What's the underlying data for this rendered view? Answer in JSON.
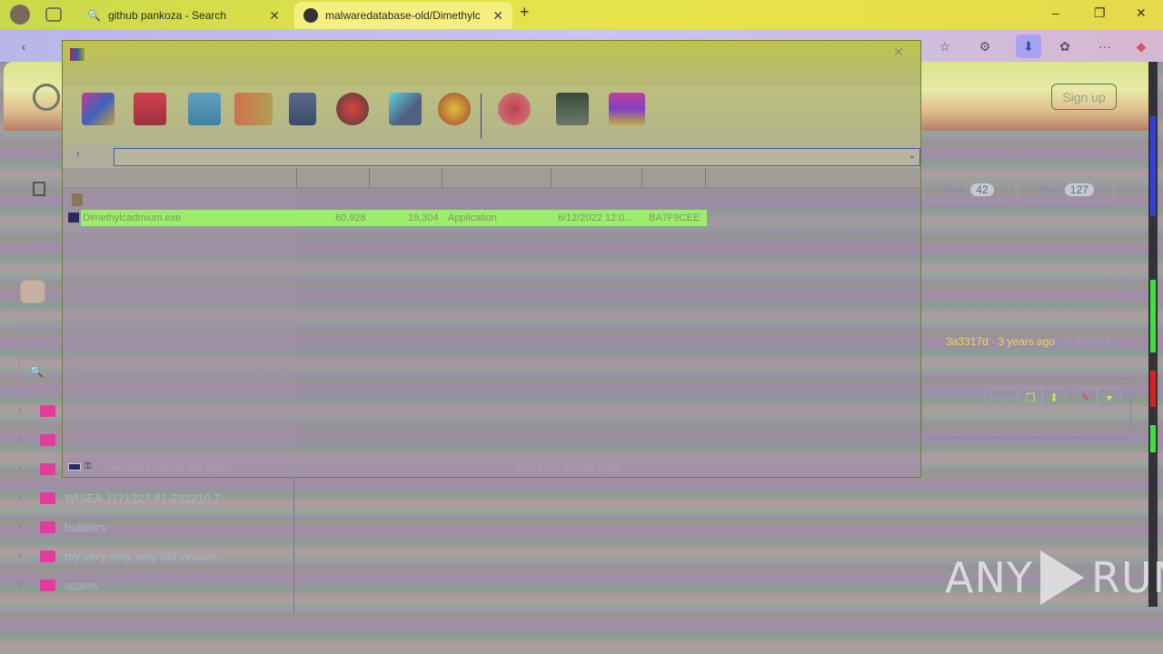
{
  "browser": {
    "tabs": [
      {
        "title": "github pankoza - Search",
        "active": false
      },
      {
        "title": "malwaredatabase-old/Dimethylc",
        "active": true
      }
    ],
    "new_tab_glyph": "+",
    "window_controls": [
      "–",
      "❐",
      "✕"
    ]
  },
  "github": {
    "sign_up": "Sign up",
    "fork": {
      "label": "Fork",
      "count": "42"
    },
    "star": {
      "label": "Star",
      "count": "127"
    },
    "commit": "3a3317d · 3 years ago",
    "history": "History",
    "raw": "Raw",
    "tree": [
      {
        "name": "",
        "icon": "folder-icon"
      },
      {
        "name": "",
        "icon": "folder-icon"
      },
      {
        "name": "",
        "icon": "folder-icon"
      },
      {
        "name": "WISEA J171227.81-232210.7",
        "icon": "folder-icon"
      },
      {
        "name": "builders",
        "icon": "folder-icon"
      },
      {
        "name": "my very very very old viruses",
        "icon": "folder-icon"
      },
      {
        "name": "scams",
        "icon": "folder-icon"
      }
    ]
  },
  "winrar": {
    "file_row": {
      "name": "Dimethylcadmium.exe",
      "size": "60,928",
      "packed": "19,304",
      "type": "Application",
      "modified": "6/12/2022 12:0...",
      "crc": "BA7F9CEE"
    },
    "status_left": "Selected 1 file, 60,928 bytes",
    "status_right": "Total 1 file, 60,928 bytes",
    "toolbar_icons": [
      "add-icon",
      "extract-icon",
      "test-icon",
      "view-icon",
      "delete-icon",
      "find-icon",
      "wizard-icon",
      "info-icon",
      "virusscan-icon",
      "comment-icon",
      "sfx-icon"
    ]
  },
  "watermark": {
    "left": "ANY",
    "right": "RUN"
  }
}
